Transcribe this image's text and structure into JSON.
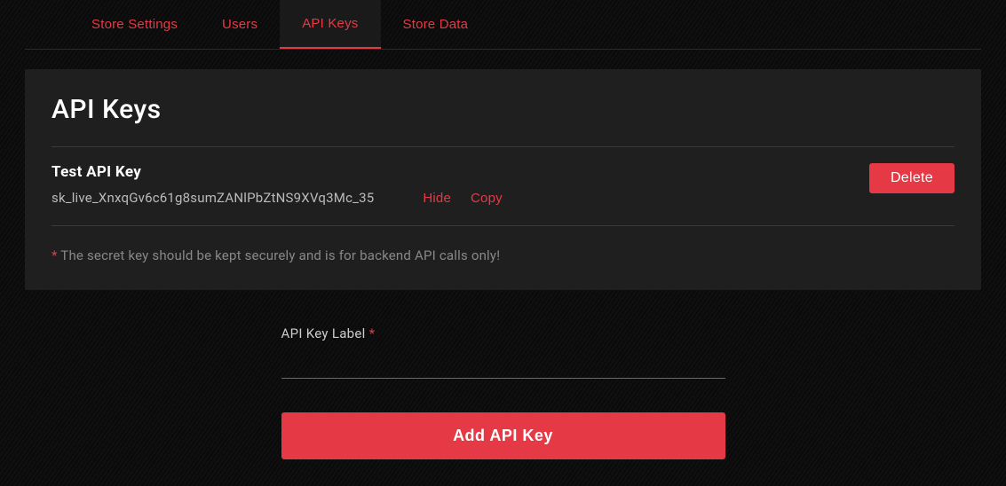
{
  "tabs": {
    "store_settings": "Store Settings",
    "users": "Users",
    "api_keys": "API Keys",
    "store_data": "Store Data"
  },
  "page_title": "API Keys",
  "key": {
    "name": "Test API Key",
    "value": "sk_live_XnxqGv6c61g8sumZANlPbZtNS9XVq3Mc_35",
    "hide_label": "Hide",
    "copy_label": "Copy",
    "delete_label": "Delete"
  },
  "note_text": "The secret key should be kept securely and is for backend API calls only!",
  "form": {
    "label": "API Key Label",
    "value": "",
    "submit_label": "Add API Key"
  }
}
